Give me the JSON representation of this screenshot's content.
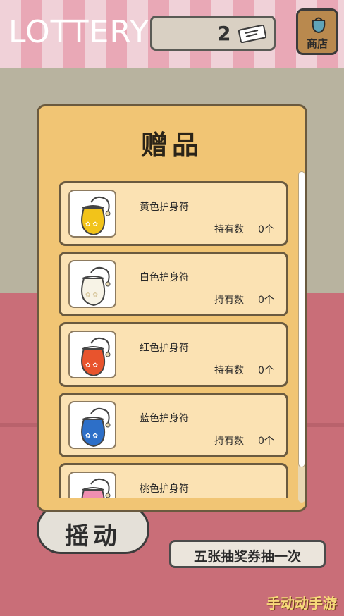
{
  "header": {
    "title": "LOTTERY",
    "ticket_count": "2",
    "ticket_icon": "ticket-icon",
    "shop_label": "商店",
    "shop_icon": "bag-icon"
  },
  "panel": {
    "title": "赠品",
    "hold_label": "持有数",
    "items": [
      {
        "name": "黄色护身符",
        "count": "0个",
        "color": "#f2c31a"
      },
      {
        "name": "白色护身符",
        "count": "0个",
        "color": "#f7f3e6"
      },
      {
        "name": "红色护身符",
        "count": "0个",
        "color": "#e8542d"
      },
      {
        "name": "蓝色护身符",
        "count": "0个",
        "color": "#2d6fc8"
      },
      {
        "name": "桃色护身符",
        "count": "",
        "color": "#f08fb0"
      }
    ]
  },
  "controls": {
    "shake_label": "摇动",
    "note_label": "五张抽奖券抽一次"
  },
  "watermark": "手动动手游",
  "colors": {
    "panel": "#f1c574",
    "card": "#fbe2b3",
    "floor": "#c96e78",
    "wall": "#b8b39f"
  }
}
